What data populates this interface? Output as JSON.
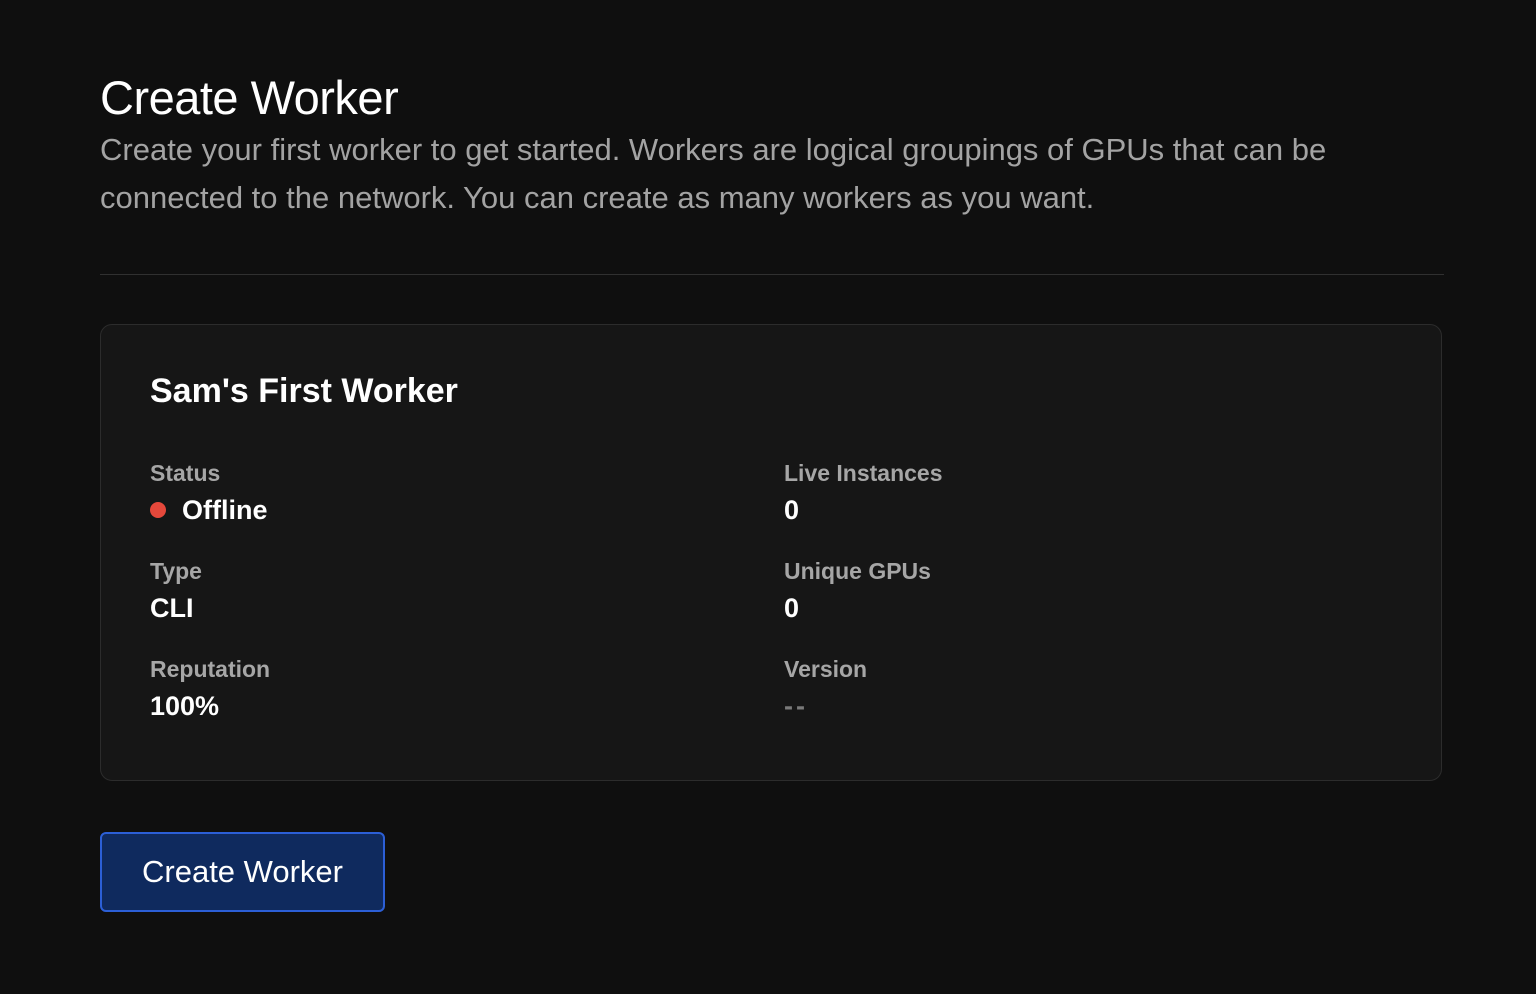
{
  "header": {
    "title": "Create Worker",
    "subtitle": "Create your first worker to get started. Workers are logical groupings of GPUs that can be connected to the network. You can create as many workers as you want."
  },
  "worker": {
    "name": "Sam's First Worker",
    "status": {
      "label": "Status",
      "value": "Offline",
      "indicator_color": "#e5483b"
    },
    "type": {
      "label": "Type",
      "value": "CLI"
    },
    "reputation": {
      "label": "Reputation",
      "value": "100%"
    },
    "live_instances": {
      "label": "Live Instances",
      "value": "0"
    },
    "unique_gpus": {
      "label": "Unique GPUs",
      "value": "0"
    },
    "version": {
      "label": "Version",
      "value": "--"
    }
  },
  "actions": {
    "create_label": "Create Worker"
  },
  "colors": {
    "background": "#0f0f0f",
    "card_background": "#161616",
    "button_background": "#0f2a5e",
    "button_border": "#2c5fd6"
  }
}
